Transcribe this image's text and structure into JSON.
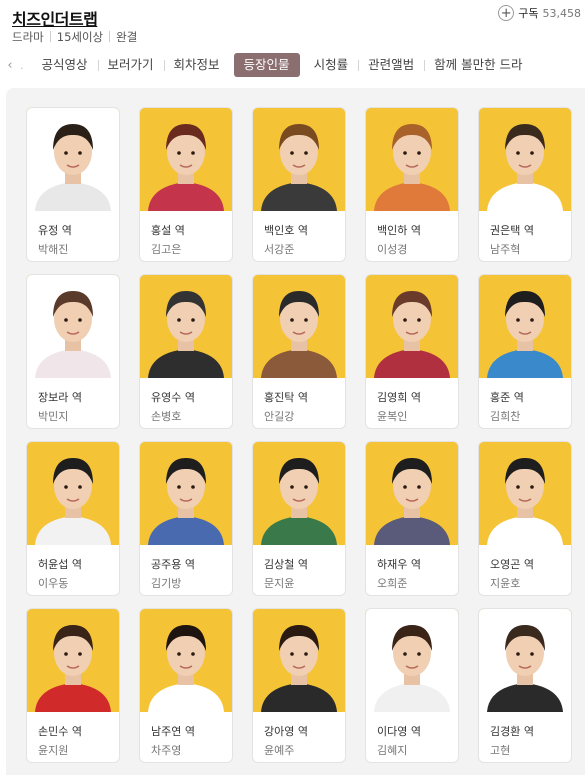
{
  "header": {
    "title": "치즈인더트랩",
    "meta": [
      "드라마",
      "15세이상",
      "완결"
    ],
    "subscribe_label": "구독",
    "subscribe_count": "53,458"
  },
  "tabs": {
    "prev_glyph": "‹",
    "items": [
      "공식영상",
      "보러가기",
      "회차정보",
      "등장인물",
      "시청률",
      "관련앨범",
      "함께 볼만한 드라"
    ],
    "active_index": 3
  },
  "colors": {
    "active_tab": "#8a6e70",
    "photo_bg": "#f5c436",
    "panel_bg": "#f3f3f3"
  },
  "cast": [
    {
      "role": "유정 역",
      "actor": "박해진",
      "photo_bg": "#ffffff",
      "shirt": "#e8e8e8",
      "hair": "#2a2018"
    },
    {
      "role": "홍설 역",
      "actor": "김고은",
      "photo_bg": "#f5c436",
      "shirt": "#c4344a",
      "hair": "#6a2a1e"
    },
    {
      "role": "백인호 역",
      "actor": "서강준",
      "photo_bg": "#f5c436",
      "shirt": "#3a3a3a",
      "hair": "#7a4a20"
    },
    {
      "role": "백인하 역",
      "actor": "이성경",
      "photo_bg": "#f5c436",
      "shirt": "#e07a3a",
      "hair": "#a8622a"
    },
    {
      "role": "권은택 역",
      "actor": "남주혁",
      "photo_bg": "#f5c436",
      "shirt": "#ffffff",
      "hair": "#3a2a1e"
    },
    {
      "role": "장보라 역",
      "actor": "박민지",
      "photo_bg": "#ffffff",
      "shirt": "#f0e6ea",
      "hair": "#5a3a2a"
    },
    {
      "role": "유영수 역",
      "actor": "손병호",
      "photo_bg": "#f5c436",
      "shirt": "#2e2e2e",
      "hair": "#333333"
    },
    {
      "role": "홍진탁 역",
      "actor": "안길강",
      "photo_bg": "#f5c436",
      "shirt": "#8a5a3a",
      "hair": "#2a2a2a"
    },
    {
      "role": "김영희 역",
      "actor": "윤복인",
      "photo_bg": "#f5c436",
      "shirt": "#b03040",
      "hair": "#6a3a2a"
    },
    {
      "role": "홍준 역",
      "actor": "김희찬",
      "photo_bg": "#f5c436",
      "shirt": "#3a8acb",
      "hair": "#1e1e1e"
    },
    {
      "role": "허윤섭 역",
      "actor": "이우동",
      "photo_bg": "#f5c436",
      "shirt": "#f2f2f2",
      "hair": "#1e1e1e"
    },
    {
      "role": "공주용 역",
      "actor": "김기방",
      "photo_bg": "#f5c436",
      "shirt": "#4a6ab0",
      "hair": "#1e1e1e"
    },
    {
      "role": "김상철 역",
      "actor": "문지윤",
      "photo_bg": "#f5c436",
      "shirt": "#3a7a4a",
      "hair": "#1e1e1e"
    },
    {
      "role": "하재우 역",
      "actor": "오희준",
      "photo_bg": "#f5c436",
      "shirt": "#5a5a7a",
      "hair": "#1e1e1e"
    },
    {
      "role": "오영곤 역",
      "actor": "지윤호",
      "photo_bg": "#f5c436",
      "shirt": "#ffffff",
      "hair": "#1e1e1e"
    },
    {
      "role": "손민수 역",
      "actor": "윤지원",
      "photo_bg": "#f5c436",
      "shirt": "#d02a2a",
      "hair": "#3a2418"
    },
    {
      "role": "남주연 역",
      "actor": "차주영",
      "photo_bg": "#f5c436",
      "shirt": "#ffffff",
      "hair": "#1e1410"
    },
    {
      "role": "강아영 역",
      "actor": "윤예주",
      "photo_bg": "#f5c436",
      "shirt": "#2a2a2a",
      "hair": "#2a1a12"
    },
    {
      "role": "이다영 역",
      "actor": "김혜지",
      "photo_bg": "#ffffff",
      "shirt": "#f0f0f0",
      "hair": "#3a2418"
    },
    {
      "role": "김경환 역",
      "actor": "고현",
      "photo_bg": "#ffffff",
      "shirt": "#2a2a2a",
      "hair": "#3a2a1e"
    }
  ]
}
